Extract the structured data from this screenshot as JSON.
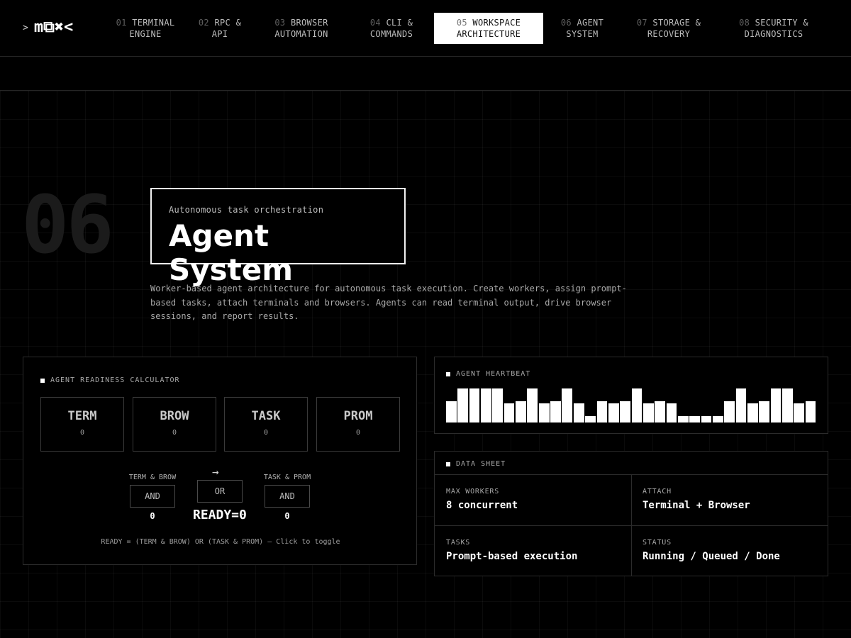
{
  "nav": {
    "prompt": ">",
    "logo": "m⧉✖<",
    "items": [
      {
        "num": "01",
        "line1": "TERMINAL",
        "line2": "ENGINE"
      },
      {
        "num": "02",
        "line1": "RPC &",
        "line2": "API"
      },
      {
        "num": "03",
        "line1": "BROWSER",
        "line2": "AUTOMATION"
      },
      {
        "num": "04",
        "line1": "CLI &",
        "line2": "COMMANDS"
      },
      {
        "num": "05",
        "line1": "WORKSPACE",
        "line2": "ARCHITECTURE"
      },
      {
        "num": "06",
        "line1": "AGENT",
        "line2": "SYSTEM"
      },
      {
        "num": "07",
        "line1": "STORAGE &",
        "line2": "RECOVERY"
      },
      {
        "num": "08",
        "line1": "SECURITY &",
        "line2": "DIAGNOSTICS"
      }
    ]
  },
  "hero": {
    "number": "06",
    "kicker": "Autonomous task orchestration",
    "title": "Agent System",
    "description": "Worker-based agent architecture for autonomous task execution. Create workers, assign prompt-based tasks, attach terminals and browsers. Agents can read terminal output, drive browser sessions, and report results."
  },
  "calculator": {
    "label": "AGENT READINESS CALCULATOR",
    "inputs": [
      {
        "name": "TERM",
        "value": "0"
      },
      {
        "name": "BROW",
        "value": "0"
      },
      {
        "name": "TASK",
        "value": "0"
      },
      {
        "name": "PROM",
        "value": "0"
      }
    ],
    "gate_left": {
      "label": "TERM & BROW",
      "op": "AND",
      "value": "0"
    },
    "gate_mid": {
      "arrow": "→",
      "op": "OR"
    },
    "gate_right": {
      "label": "TASK & PROM",
      "op": "AND",
      "value": "0"
    },
    "ready": "READY=0",
    "formula": "READY = (TERM & BROW) OR (TASK & PROM) — Click to toggle"
  },
  "heartbeat": {
    "label": "AGENT HEARTBEAT",
    "levels": [
      0.62,
      1,
      1,
      1,
      1,
      0.56,
      0.62,
      1,
      0.56,
      0.62,
      1,
      0.56,
      0.19,
      0.62,
      0.56,
      0.62,
      1,
      0.56,
      0.62,
      0.56,
      0.19,
      0.19,
      0.19,
      0.19,
      0.62,
      1,
      0.56,
      0.62,
      1,
      1,
      0.56,
      0.62
    ]
  },
  "datasheet": {
    "label": "DATA SHEET",
    "rows": [
      [
        {
          "key": "MAX WORKERS",
          "value": "8 concurrent"
        },
        {
          "key": "ATTACH",
          "value": "Terminal + Browser"
        }
      ],
      [
        {
          "key": "TASKS",
          "value": "Prompt-based execution"
        },
        {
          "key": "STATUS",
          "value": "Running / Queued / Done"
        }
      ]
    ]
  }
}
